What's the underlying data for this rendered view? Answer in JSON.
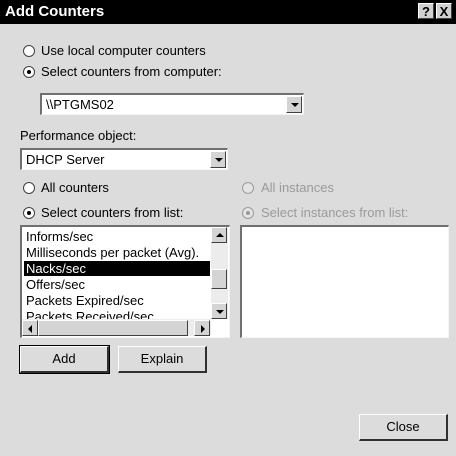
{
  "window": {
    "title": "Add Counters",
    "help_label": "?",
    "close_label": "X"
  },
  "source": {
    "local_label": "Use local computer counters",
    "computer_label": "Select counters from computer:",
    "selected": "computer",
    "computer_value": "\\\\PTGMS02"
  },
  "performance_object": {
    "label": "Performance object:",
    "value": "DHCP Server"
  },
  "counters": {
    "all_label": "All counters",
    "list_label": "Select counters from list:",
    "selected_mode": "list",
    "items": [
      "Informs/sec",
      "Milliseconds per packet (Avg).",
      "Nacks/sec",
      "Offers/sec",
      "Packets Expired/sec",
      "Packets Received/sec"
    ],
    "selected_item": "Nacks/sec"
  },
  "instances": {
    "all_label": "All instances",
    "list_label": "Select instances from list:",
    "enabled": false,
    "items": []
  },
  "buttons": {
    "add": "Add",
    "explain": "Explain",
    "close": "Close"
  },
  "colors": {
    "titlebar": "#000000",
    "dialog_bg": "#dcdcdc",
    "selection": "#000000",
    "disabled_text": "#9a9a9a"
  }
}
